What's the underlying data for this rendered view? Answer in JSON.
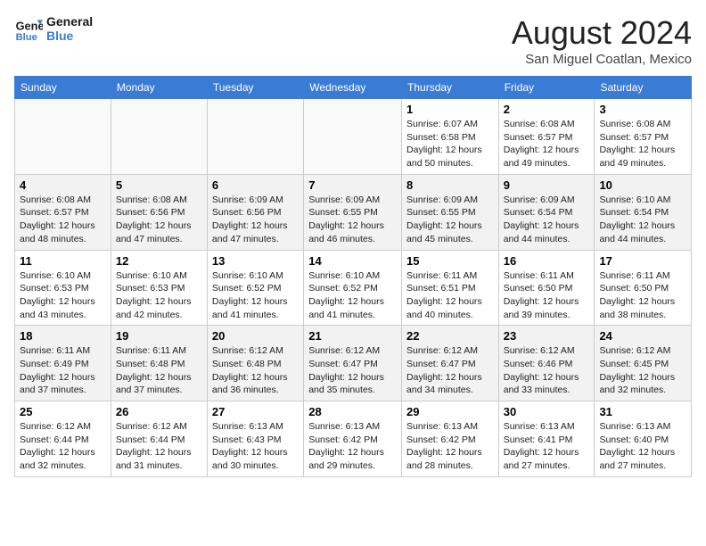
{
  "header": {
    "logo_line1": "General",
    "logo_line2": "Blue",
    "month_year": "August 2024",
    "location": "San Miguel Coatlan, Mexico"
  },
  "weekdays": [
    "Sunday",
    "Monday",
    "Tuesday",
    "Wednesday",
    "Thursday",
    "Friday",
    "Saturday"
  ],
  "weeks": [
    [
      {
        "day": "",
        "empty": true
      },
      {
        "day": "",
        "empty": true
      },
      {
        "day": "",
        "empty": true
      },
      {
        "day": "",
        "empty": true
      },
      {
        "day": "1",
        "sunrise": "6:07 AM",
        "sunset": "6:58 PM",
        "daylight": "12 hours and 50 minutes."
      },
      {
        "day": "2",
        "sunrise": "6:08 AM",
        "sunset": "6:57 PM",
        "daylight": "12 hours and 49 minutes."
      },
      {
        "day": "3",
        "sunrise": "6:08 AM",
        "sunset": "6:57 PM",
        "daylight": "12 hours and 49 minutes."
      }
    ],
    [
      {
        "day": "4",
        "sunrise": "6:08 AM",
        "sunset": "6:57 PM",
        "daylight": "12 hours and 48 minutes."
      },
      {
        "day": "5",
        "sunrise": "6:08 AM",
        "sunset": "6:56 PM",
        "daylight": "12 hours and 47 minutes."
      },
      {
        "day": "6",
        "sunrise": "6:09 AM",
        "sunset": "6:56 PM",
        "daylight": "12 hours and 47 minutes."
      },
      {
        "day": "7",
        "sunrise": "6:09 AM",
        "sunset": "6:55 PM",
        "daylight": "12 hours and 46 minutes."
      },
      {
        "day": "8",
        "sunrise": "6:09 AM",
        "sunset": "6:55 PM",
        "daylight": "12 hours and 45 minutes."
      },
      {
        "day": "9",
        "sunrise": "6:09 AM",
        "sunset": "6:54 PM",
        "daylight": "12 hours and 44 minutes."
      },
      {
        "day": "10",
        "sunrise": "6:10 AM",
        "sunset": "6:54 PM",
        "daylight": "12 hours and 44 minutes."
      }
    ],
    [
      {
        "day": "11",
        "sunrise": "6:10 AM",
        "sunset": "6:53 PM",
        "daylight": "12 hours and 43 minutes."
      },
      {
        "day": "12",
        "sunrise": "6:10 AM",
        "sunset": "6:53 PM",
        "daylight": "12 hours and 42 minutes."
      },
      {
        "day": "13",
        "sunrise": "6:10 AM",
        "sunset": "6:52 PM",
        "daylight": "12 hours and 41 minutes."
      },
      {
        "day": "14",
        "sunrise": "6:10 AM",
        "sunset": "6:52 PM",
        "daylight": "12 hours and 41 minutes."
      },
      {
        "day": "15",
        "sunrise": "6:11 AM",
        "sunset": "6:51 PM",
        "daylight": "12 hours and 40 minutes."
      },
      {
        "day": "16",
        "sunrise": "6:11 AM",
        "sunset": "6:50 PM",
        "daylight": "12 hours and 39 minutes."
      },
      {
        "day": "17",
        "sunrise": "6:11 AM",
        "sunset": "6:50 PM",
        "daylight": "12 hours and 38 minutes."
      }
    ],
    [
      {
        "day": "18",
        "sunrise": "6:11 AM",
        "sunset": "6:49 PM",
        "daylight": "12 hours and 37 minutes."
      },
      {
        "day": "19",
        "sunrise": "6:11 AM",
        "sunset": "6:48 PM",
        "daylight": "12 hours and 37 minutes."
      },
      {
        "day": "20",
        "sunrise": "6:12 AM",
        "sunset": "6:48 PM",
        "daylight": "12 hours and 36 minutes."
      },
      {
        "day": "21",
        "sunrise": "6:12 AM",
        "sunset": "6:47 PM",
        "daylight": "12 hours and 35 minutes."
      },
      {
        "day": "22",
        "sunrise": "6:12 AM",
        "sunset": "6:47 PM",
        "daylight": "12 hours and 34 minutes."
      },
      {
        "day": "23",
        "sunrise": "6:12 AM",
        "sunset": "6:46 PM",
        "daylight": "12 hours and 33 minutes."
      },
      {
        "day": "24",
        "sunrise": "6:12 AM",
        "sunset": "6:45 PM",
        "daylight": "12 hours and 32 minutes."
      }
    ],
    [
      {
        "day": "25",
        "sunrise": "6:12 AM",
        "sunset": "6:44 PM",
        "daylight": "12 hours and 32 minutes."
      },
      {
        "day": "26",
        "sunrise": "6:12 AM",
        "sunset": "6:44 PM",
        "daylight": "12 hours and 31 minutes."
      },
      {
        "day": "27",
        "sunrise": "6:13 AM",
        "sunset": "6:43 PM",
        "daylight": "12 hours and 30 minutes."
      },
      {
        "day": "28",
        "sunrise": "6:13 AM",
        "sunset": "6:42 PM",
        "daylight": "12 hours and 29 minutes."
      },
      {
        "day": "29",
        "sunrise": "6:13 AM",
        "sunset": "6:42 PM",
        "daylight": "12 hours and 28 minutes."
      },
      {
        "day": "30",
        "sunrise": "6:13 AM",
        "sunset": "6:41 PM",
        "daylight": "12 hours and 27 minutes."
      },
      {
        "day": "31",
        "sunrise": "6:13 AM",
        "sunset": "6:40 PM",
        "daylight": "12 hours and 27 minutes."
      }
    ]
  ],
  "labels": {
    "sunrise_prefix": "Sunrise: ",
    "sunset_prefix": "Sunset: ",
    "daylight_prefix": "Daylight: "
  }
}
